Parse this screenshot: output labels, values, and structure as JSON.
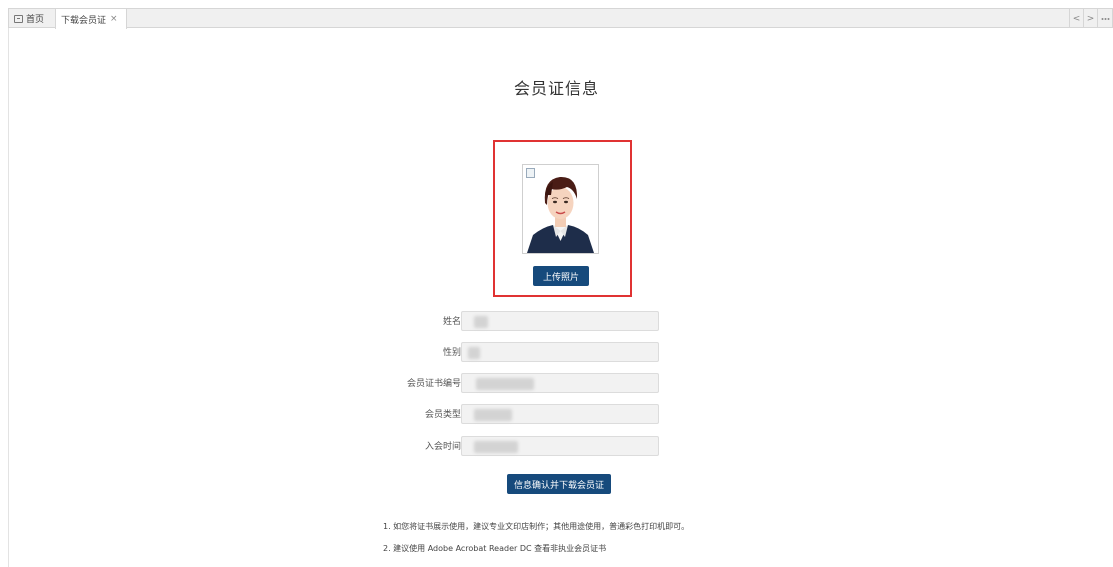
{
  "tabs": {
    "home_label": "首页",
    "active_label": "下载会员证",
    "close_glyph": "×",
    "prev_glyph": "<",
    "next_glyph": ">",
    "more_glyph": "▸▸"
  },
  "page": {
    "title": "会员证信息"
  },
  "photo": {
    "upload_label": "上传照片"
  },
  "form": {
    "fields": [
      {
        "label": "姓名",
        "value": ""
      },
      {
        "label": "性别",
        "value": ""
      },
      {
        "label": "会员证书编号",
        "value": ""
      },
      {
        "label": "会员类型",
        "value": ""
      },
      {
        "label": "入会时间",
        "value": ""
      }
    ]
  },
  "actions": {
    "confirm_label": "信息确认并下载会员证"
  },
  "notes": [
    "1. 如您将证书展示使用，建议专业文印店制作；其他用途使用，普通彩色打印机即可。",
    "2. 建议使用 Adobe Acrobat Reader DC 查看非执业会员证书"
  ],
  "colors": {
    "primary_button": "#164a7c",
    "highlight_border": "#e03232"
  }
}
